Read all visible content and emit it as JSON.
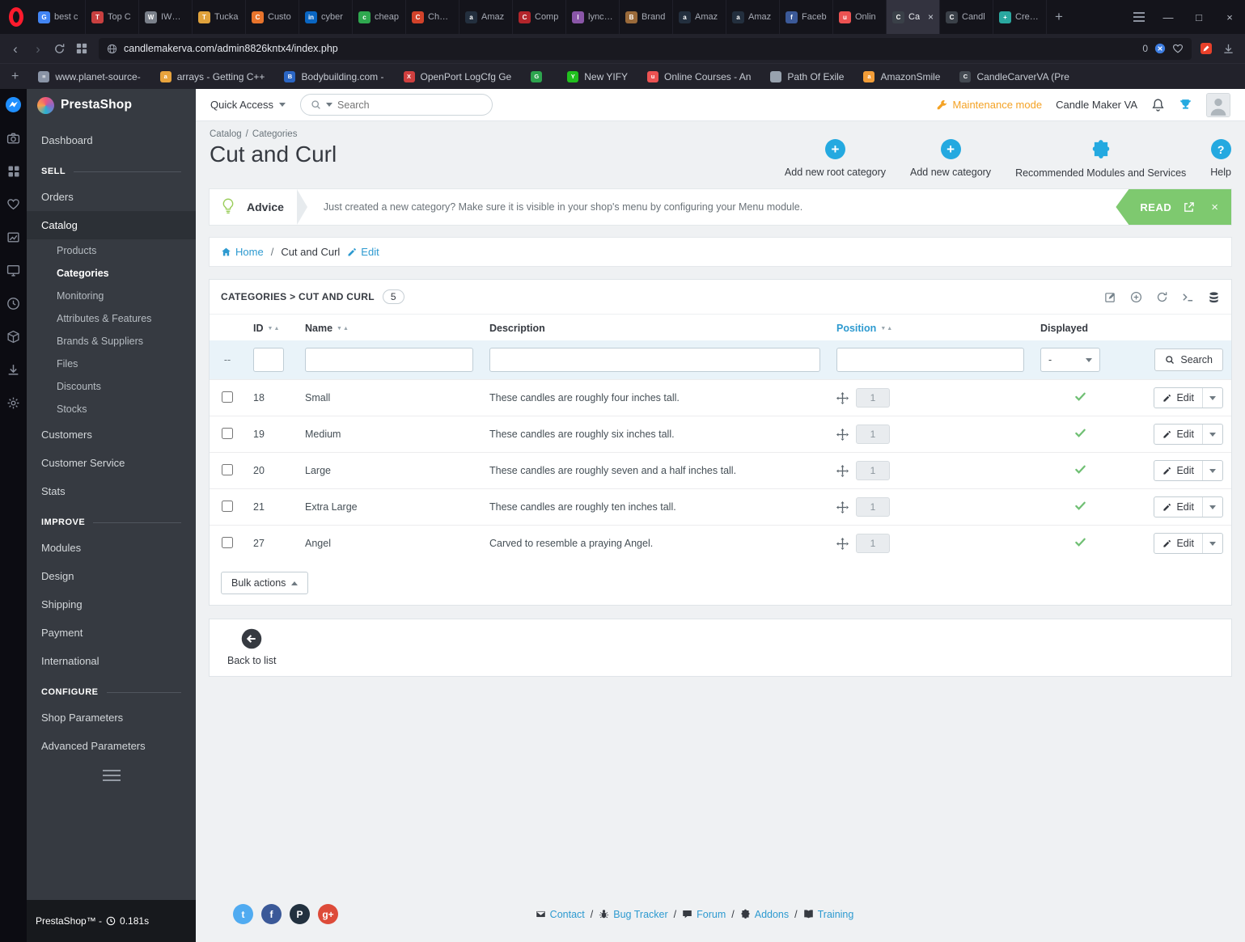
{
  "browser": {
    "tabs": [
      {
        "label": "best c",
        "glyph": "G",
        "color": "#4285f4"
      },
      {
        "label": "Top C",
        "glyph": "T",
        "color": "#c94040"
      },
      {
        "label": "IWB C",
        "glyph": "W",
        "color": "#7a808a"
      },
      {
        "label": "Tucka",
        "glyph": "T",
        "color": "#e0a23c"
      },
      {
        "label": "Custo",
        "glyph": "C",
        "color": "#e8742c"
      },
      {
        "label": "cyber",
        "glyph": "in",
        "color": "#0a66c2"
      },
      {
        "label": "cheap",
        "glyph": "c",
        "color": "#2fa84f"
      },
      {
        "label": "Cheap",
        "glyph": "C",
        "color": "#d2422a"
      },
      {
        "label": "Amaz",
        "glyph": "a",
        "color": "#232f3e"
      },
      {
        "label": "Comp",
        "glyph": "C",
        "color": "#b3252b"
      },
      {
        "label": "lynchb",
        "glyph": "l",
        "color": "#8a56a8"
      },
      {
        "label": "Brand",
        "glyph": "B",
        "color": "#9a6a3a"
      },
      {
        "label": "Amaz",
        "glyph": "a",
        "color": "#232f3e"
      },
      {
        "label": "Amaz",
        "glyph": "a",
        "color": "#232f3e"
      },
      {
        "label": "Faceb",
        "glyph": "f",
        "color": "#3b5998"
      },
      {
        "label": "Onlin",
        "glyph": "u",
        "color": "#ec5252"
      },
      {
        "label": "Ca",
        "glyph": "C",
        "color": "#3a4048",
        "active": true
      },
      {
        "label": "Candl",
        "glyph": "C",
        "color": "#3a4048"
      },
      {
        "label": "Create",
        "glyph": "+",
        "color": "#2aa8a0"
      }
    ],
    "new_tab": "+",
    "nav": {
      "back": "‹",
      "forward": "›"
    },
    "url": "candlemakerva.com/admin8826kntx4/index.php",
    "blocked_count": "0",
    "bookmarks": [
      {
        "label": "www.planet-source-",
        "glyph": "≡",
        "color": "#8a94a6"
      },
      {
        "label": "arrays - Getting C++",
        "glyph": "a",
        "color": "#e8a33d"
      },
      {
        "label": "Bodybuilding.com -",
        "glyph": "B",
        "color": "#2b66c4"
      },
      {
        "label": "OpenPort LogCfg Ge",
        "glyph": "X",
        "color": "#d03f3f"
      },
      {
        "label": "",
        "glyph": "G",
        "color": "#2da44e"
      },
      {
        "label": "New YIFY",
        "glyph": "Y",
        "color": "#21c01e"
      },
      {
        "label": "Online Courses - An",
        "glyph": "u",
        "color": "#ec5252"
      },
      {
        "label": "Path Of Exile",
        "glyph": "",
        "color": "#98a2ae"
      },
      {
        "label": "AmazonSmile",
        "glyph": "a",
        "color": "#f29d38"
      },
      {
        "label": "CandleCarverVA (Pre",
        "glyph": "C",
        "color": "#444a52"
      }
    ],
    "window": {
      "minimize": "—",
      "maximize": "□",
      "close": "×"
    }
  },
  "sidebar": {
    "logo": "PrestaShop",
    "dashboard": "Dashboard",
    "sell_title": "SELL",
    "orders": "Orders",
    "catalog": "Catalog",
    "catalog_sub": [
      "Products",
      "Categories",
      "Monitoring",
      "Attributes & Features",
      "Brands & Suppliers",
      "Files",
      "Discounts",
      "Stocks"
    ],
    "customers": "Customers",
    "customer_service": "Customer Service",
    "stats": "Stats",
    "improve_title": "IMPROVE",
    "modules": "Modules",
    "design": "Design",
    "shipping": "Shipping",
    "payment": "Payment",
    "international": "International",
    "configure_title": "CONFIGURE",
    "shop_parameters": "Shop Parameters",
    "advanced_parameters": "Advanced Parameters",
    "footer_brand": "PrestaShop™ -",
    "load_time": "0.181s"
  },
  "header": {
    "quick_access": "Quick Access",
    "search_placeholder": "Search",
    "maintenance_mode": "Maintenance mode",
    "shop_name": "Candle Maker VA"
  },
  "page": {
    "breadcrumb_parent": "Catalog",
    "breadcrumb_sep": "/",
    "breadcrumb_current": "Categories",
    "title": "Cut and Curl",
    "action_add_root": "Add new root category",
    "action_add": "Add new category",
    "action_modules": "Recommended Modules and Services",
    "action_help": "Help"
  },
  "advice": {
    "label": "Advice",
    "text": "Just created a new category? Make sure it is visible in your shop's menu by configuring your Menu module.",
    "read": "READ",
    "close": "×"
  },
  "crumbbar": {
    "home": "Home",
    "sep": "/",
    "current": "Cut and Curl",
    "edit": "Edit"
  },
  "panel": {
    "title": "CATEGORIES > CUT AND CURL",
    "count": "5",
    "col_id": "ID",
    "col_name": "Name",
    "col_description": "Description",
    "col_position": "Position",
    "col_displayed": "Displayed",
    "sort_asc": "▲",
    "sort_desc": "▼",
    "filter_dash": "--",
    "displayed_filter": "-",
    "search_button": "Search",
    "edit_button": "Edit",
    "bulk_actions": "Bulk actions",
    "rows": [
      {
        "id": "18",
        "name": "Small",
        "description": "These candles are roughly four inches tall.",
        "position": "1"
      },
      {
        "id": "19",
        "name": "Medium",
        "description": "These candles are roughly six inches tall.",
        "position": "1"
      },
      {
        "id": "20",
        "name": "Large",
        "description": "These candles are roughly seven and a half inches tall.",
        "position": "1"
      },
      {
        "id": "21",
        "name": "Extra Large",
        "description": "These candles are roughly ten inches tall.",
        "position": "1"
      },
      {
        "id": "27",
        "name": "Angel",
        "description": "Carved to resemble a praying Angel.",
        "position": "1"
      }
    ]
  },
  "back_to_list": "Back to list",
  "app_footer": {
    "sep": "/",
    "links": [
      "Contact",
      "Bug Tracker",
      "Forum",
      "Addons",
      "Training"
    ],
    "socials": [
      {
        "name": "twitter",
        "glyph": "t",
        "color": "#50abf1"
      },
      {
        "name": "facebook",
        "glyph": "f",
        "color": "#3b5998"
      },
      {
        "name": "prestashop",
        "glyph": "P",
        "color": "#22313f"
      },
      {
        "name": "googleplus",
        "glyph": "g+",
        "color": "#dd4b39"
      }
    ]
  },
  "colors": {
    "accent_blue": "#24a9e0",
    "link_blue": "#2d9ad0",
    "success_green": "#6fbf73",
    "read_green": "#7ec96f",
    "maintenance_orange": "#f4a224",
    "sidebar_dark": "#363a41"
  }
}
